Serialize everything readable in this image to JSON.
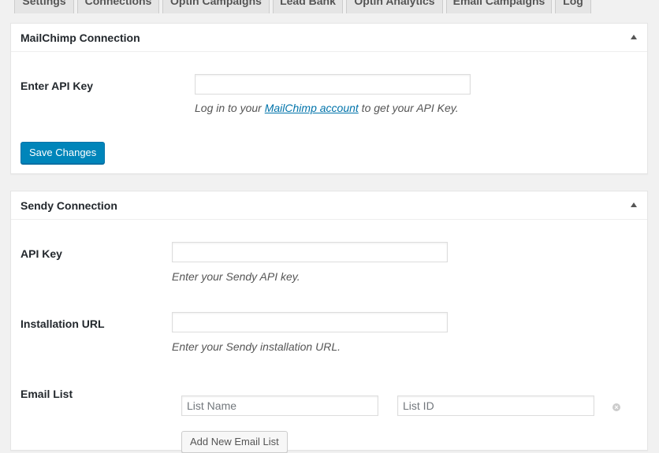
{
  "tabs": [
    {
      "label": "Settings"
    },
    {
      "label": "Connections"
    },
    {
      "label": "Optin Campaigns"
    },
    {
      "label": "Lead Bank"
    },
    {
      "label": "Optin Analytics"
    },
    {
      "label": "Email Campaigns"
    },
    {
      "label": "Log"
    }
  ],
  "mailchimp": {
    "title": "MailChimp Connection",
    "api_key_label": "Enter API Key",
    "api_key_value": "",
    "desc_prefix": "Log in to your ",
    "desc_link": "MailChimp account",
    "desc_suffix": " to get your API Key.",
    "save_label": "Save Changes"
  },
  "sendy": {
    "title": "Sendy Connection",
    "api_key_label": "API Key",
    "api_key_value": "",
    "api_key_desc": "Enter your Sendy API key.",
    "install_url_label": "Installation URL",
    "install_url_value": "",
    "install_url_desc": "Enter your Sendy installation URL.",
    "email_list_label": "Email List",
    "list_name_placeholder": "List Name",
    "list_id_placeholder": "List ID",
    "add_list_label": "Add New Email List"
  },
  "colors": {
    "primary_button": "#0085ba",
    "link": "#0073aa",
    "background": "#f1f1f1"
  }
}
